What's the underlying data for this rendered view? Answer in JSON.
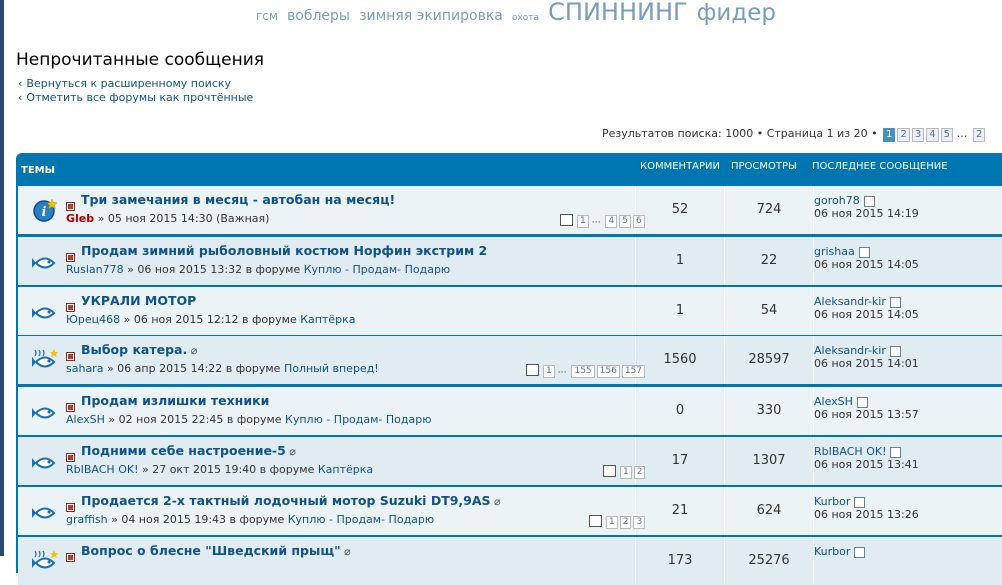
{
  "tags": [
    "гсм",
    "воблеры",
    "зимняя экипировка",
    "охота",
    "СПИННИНГ",
    "фидер"
  ],
  "page_title": "Непрочитанные сообщения",
  "links": [
    "Вернуться к расширенному поиску",
    "Отметить все форумы как прочтённые"
  ],
  "pagination": {
    "text": "Результатов поиска: 1000 • Страница 1 из 20 •",
    "pages": [
      "1",
      "2",
      "3",
      "4",
      "5",
      "…",
      "2"
    ]
  },
  "headers": {
    "topics": "Темы",
    "comments": "Комментарии",
    "views": "Просмотры",
    "last": "Последнее сообщение"
  },
  "rows": [
    {
      "title": "Три замечания в месяц - автобан на месяц!",
      "author": "Gleb",
      "meta": "» 05 ноя 2015 14:30 (Важная)",
      "forum": "",
      "pages": [
        "1",
        "…",
        "4",
        "5",
        "6"
      ],
      "comments": "52",
      "views": "724",
      "last_user": "goroh78",
      "last_date": "06 ноя 2015 14:19",
      "icon": "info-icon"
    },
    {
      "title": "Продам зимний рыболовный костюм Норфин экстрим 2",
      "author": "Ruslan778",
      "meta": "» 06 ноя 2015 13:32 в форуме",
      "forum": "Куплю - Продам- Подарю",
      "pages": [],
      "comments": "1",
      "views": "22",
      "last_user": "grishaa",
      "last_date": "06 ноя 2015 14:05",
      "icon": "fish-icon"
    },
    {
      "title": "УКРАЛИ МОТОР",
      "author": "Юрец468",
      "meta": "» 06 ноя 2015 12:12 в форуме",
      "forum": "Каптёрка",
      "pages": [],
      "comments": "1",
      "views": "54",
      "last_user": "Aleksandr-kir",
      "last_date": "06 ноя 2015 14:05",
      "icon": "fish-icon"
    },
    {
      "title": "Выбор катера.",
      "author": "sahara",
      "meta": "» 06 апр 2015 14:22 в форуме",
      "forum": "Полный вперед!",
      "pages": [
        "1",
        "…",
        "155",
        "156",
        "157"
      ],
      "comments": "1560",
      "views": "28597",
      "last_user": "Aleksandr-kir",
      "last_date": "06 ноя 2015 14:01",
      "icon": "hot-fish-icon",
      "attach": true
    },
    {
      "title": "Продам излишки техники",
      "author": "AlexSH",
      "meta": "» 02 ноя 2015 22:45 в форуме",
      "forum": "Куплю - Продам- Подарю",
      "pages": [],
      "comments": "0",
      "views": "330",
      "last_user": "AlexSH",
      "last_date": "06 ноя 2015 13:57",
      "icon": "fish-icon"
    },
    {
      "title": "Подними себе настроение-5",
      "author": "RbIBACH OK!",
      "meta": "» 27 окт 2015 19:40 в форуме",
      "forum": "Каптёрка",
      "pages": [
        "1",
        "2"
      ],
      "comments": "17",
      "views": "1307",
      "last_user": "RbIBACH OK!",
      "last_date": "06 ноя 2015 13:41",
      "icon": "fish-icon",
      "attach": true
    },
    {
      "title": "Продается 2-х тактный лодочный мотор Suzuki DT9,9AS",
      "author": "graffish",
      "meta": "» 04 ноя 2015 19:43 в форуме",
      "forum": "Куплю - Продам- Подарю",
      "pages": [
        "1",
        "2",
        "3"
      ],
      "comments": "21",
      "views": "624",
      "last_user": "Kurbor",
      "last_date": "06 ноя 2015 13:26",
      "icon": "fish-icon",
      "attach": true
    },
    {
      "title": "Вопрос о блесне \"Шведский прыщ\"",
      "author": "",
      "meta": "",
      "forum": "",
      "pages": [],
      "comments": "173",
      "views": "25276",
      "last_user": "Kurbor",
      "last_date": "",
      "icon": "hot-fish-icon",
      "attach": true
    }
  ],
  "colors": {
    "accent": "#0076b1",
    "link": "#105289",
    "row1": "#ecf3f7",
    "row2": "#e1ebf2"
  }
}
